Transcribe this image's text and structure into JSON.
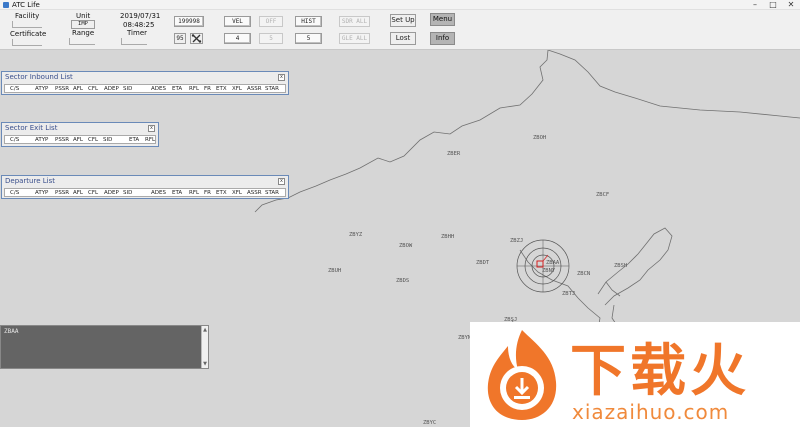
{
  "window": {
    "title": "ATC Life",
    "minimize": "–",
    "maximize": "□",
    "close": "✕"
  },
  "toolbar": {
    "facility_label": "Facility",
    "certificate_label": "Certificate",
    "unit_label": "Unit",
    "unit_value": "IMP",
    "range_label": "Range",
    "date": "2019/07/31",
    "time": "08:48:25",
    "timer_label": "Timer",
    "squawk_button": "199998",
    "range_button": "95",
    "vel_button": "VEL",
    "vel_value": "4",
    "off_button": "OFF",
    "off_value": "5",
    "hist_button": "HIST",
    "hist_value": "5",
    "sdr_all_button": "SDR ALL",
    "gle_all_button": "GLE ALL",
    "setup_button": "Set Up",
    "lost_button": "Lost",
    "menu_button": "Menu",
    "info_button": "Info"
  },
  "panels": {
    "inbound": {
      "title": "Sector Inbound List",
      "close": "x",
      "columns": [
        "C/S",
        "ATYP",
        "PSSR",
        "AFL",
        "CFL",
        "ADEP",
        "SID",
        "ADES",
        "ETA",
        "RFL",
        "FR",
        "ETX",
        "XFL",
        "ASSR",
        "STAR"
      ]
    },
    "exit": {
      "title": "Sector Exit List",
      "close": "x",
      "columns": [
        "C/S",
        "ATYP",
        "PSSR",
        "AFL",
        "CFL",
        "SID",
        "ETA",
        "RFL"
      ]
    },
    "departure": {
      "title": "Departure List",
      "close": "x",
      "columns": [
        "C/S",
        "ATYP",
        "PSSR",
        "AFL",
        "CFL",
        "ADEP",
        "SID",
        "ADES",
        "ETA",
        "RFL",
        "FR",
        "ETX",
        "XFL",
        "ASSR",
        "STAR"
      ]
    }
  },
  "log": {
    "text": "ZBAA",
    "scroll_up": "▲",
    "scroll_down": "▼"
  },
  "map": {
    "sectors": [
      "ZBOH",
      "ZBER",
      "ZBCF",
      "ZBYZ",
      "ZBOW",
      "ZBHH",
      "ZBZJ",
      "ZBAA",
      "ZBNY",
      "ZBDT",
      "ZBCN",
      "ZBSH",
      "ZBUH",
      "ZBDS",
      "ZBTJ",
      "ZBSJ",
      "ZBYN",
      "ZBYC"
    ],
    "colors": {
      "background": "#d6d6d6",
      "border": "#707070",
      "ring": "#555555",
      "target": "#d42020"
    }
  },
  "watermark": {
    "chinese": "下载火",
    "url": "xiazaihuo.com",
    "accent": "#f0762a"
  }
}
